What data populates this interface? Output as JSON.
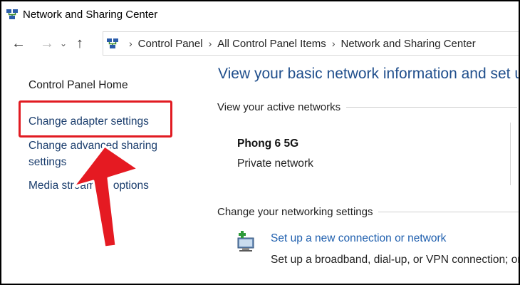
{
  "window": {
    "title": "Network and Sharing Center",
    "icon": "network-center-icon"
  },
  "nav": {
    "back_icon": "back-arrow-icon",
    "forward_icon": "forward-arrow-icon",
    "recent_icon": "chevron-down-icon",
    "up_icon": "up-arrow-icon"
  },
  "breadcrumb": {
    "items": [
      "Control Panel",
      "All Control Panel Items",
      "Network and Sharing Center"
    ]
  },
  "sidebar": {
    "home": "Control Panel Home",
    "adapter": "Change adapter settings",
    "advanced": "Change advanced sharing settings",
    "media": "Media streaming options"
  },
  "main": {
    "title": "View your basic network information and set up connections",
    "active_header": "View your active networks",
    "network_name": "Phong 6 5G",
    "network_type": "Private network",
    "settings_header": "Change your networking settings",
    "task_link": "Set up a new connection or network",
    "task_desc": "Set up a broadband, dial-up, or VPN connection; or set up a router or access point."
  },
  "annotation": {
    "color": "#e11b22"
  }
}
